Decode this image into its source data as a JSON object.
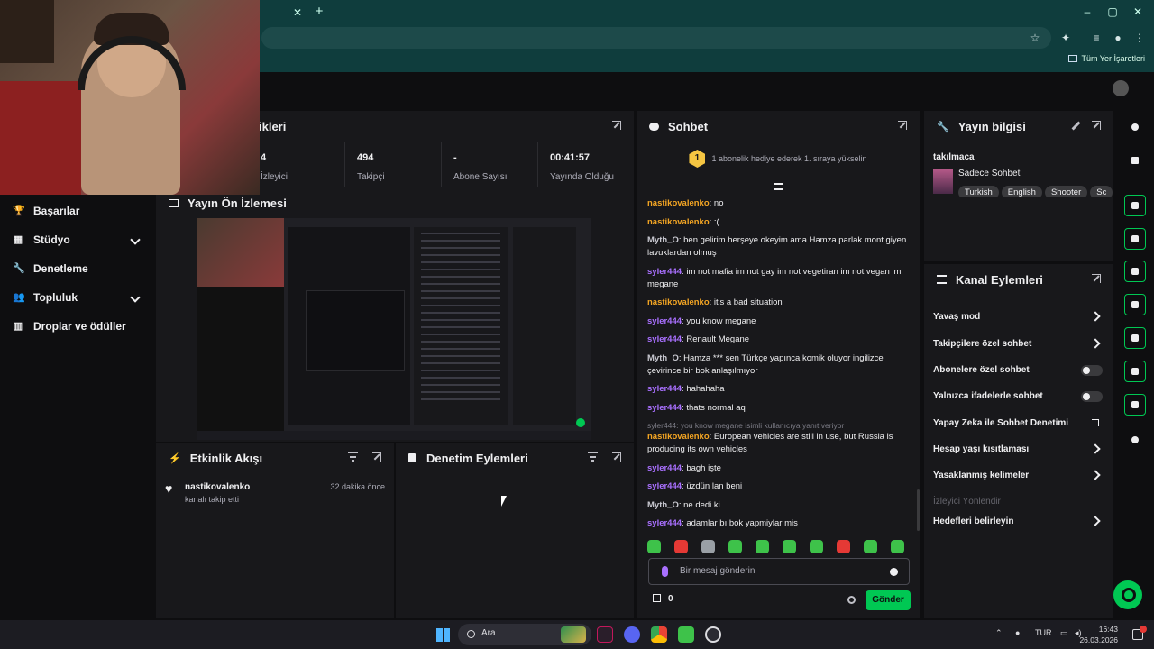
{
  "left_nav": {
    "items": [
      {
        "label": "Başarılar",
        "icon": "trophy-icon"
      },
      {
        "label": "Stüdyo",
        "icon": "studio-icon"
      },
      {
        "label": "Denetleme",
        "icon": "wrench-icon"
      },
      {
        "label": "Topluluk",
        "icon": "community-icon"
      },
      {
        "label": "Droplar ve ödüller",
        "icon": "drops-icon"
      }
    ]
  },
  "stats": {
    "title": "ikleri",
    "items": [
      {
        "value": "4",
        "label": "İzleyici"
      },
      {
        "value": "494",
        "label": "Takipçi"
      },
      {
        "value": "-",
        "label": "Abone Sayısı"
      },
      {
        "value": "00:41:57",
        "label": "Yayında Olduğu"
      }
    ]
  },
  "preview": {
    "title": "Yayın Ön İzlemesi"
  },
  "activity": {
    "title": "Etkinlik Akışı",
    "events": [
      {
        "name": "nastikovalenko",
        "desc": "kanalı takip etti",
        "time": "32 dakika önce"
      }
    ]
  },
  "moderation": {
    "title": "Denetim Eylemleri"
  },
  "chat": {
    "title": "Sohbet",
    "pinned_rank": "1",
    "pinned_text": "1 abonelik hediye ederek 1. sıraya yükselin",
    "input_placeholder": "Bir mesaj gönderin",
    "points": "0",
    "send_label": "Gönder",
    "messages": [
      {
        "user": "nastikovalenko",
        "color": "#f5a623",
        "text": "no"
      },
      {
        "user": "nastikovalenko",
        "color": "#f5a623",
        "text": ":("
      },
      {
        "user": "Myth_O",
        "color": "#c9c9d1",
        "text": "ben gelirim herşeye okeyim ama Hamza parlak mont giyen lavuklardan olmuş"
      },
      {
        "user": "syler444",
        "color": "#a970ff",
        "text": "im not mafia im not gay im not vegetiran im not vegan im megane"
      },
      {
        "user": "nastikovalenko",
        "color": "#f5a623",
        "text": "it's a bad situation"
      },
      {
        "user": "syler444",
        "color": "#a970ff",
        "text": "you know megane"
      },
      {
        "user": "syler444",
        "color": "#a970ff",
        "text": "Renault Megane"
      },
      {
        "user": "Myth_O",
        "color": "#c9c9d1",
        "text": "Hamza *** sen Türkçe yapınca komik oluyor ingilizce çevirince bir bok anlaşılmıyor"
      },
      {
        "user": "syler444",
        "color": "#a970ff",
        "text": "hahahaha"
      },
      {
        "user": "syler444",
        "color": "#a970ff",
        "text": "thats normal aq"
      },
      {
        "user": "nastikovalenko",
        "color": "#f5a623",
        "text": "European vehicles are still in use, but Russia is producing its own vehicles",
        "reply": "syler444: you know megane isimli kullanıcıya yanıt veriyor"
      },
      {
        "user": "syler444",
        "color": "#a970ff",
        "text": "bagh işte"
      },
      {
        "user": "syler444",
        "color": "#a970ff",
        "text": "üzdün lan beni"
      },
      {
        "user": "Myth_O",
        "color": "#c9c9d1",
        "text": "ne dedi ki"
      },
      {
        "user": "syler444",
        "color": "#a970ff",
        "text": "adamlar bı bok yapmiylar mis"
      }
    ]
  },
  "stream_info": {
    "title": "Yayın bilgisi",
    "stream_title": "takılmaca",
    "category": "Sadece Sohbet",
    "tags": [
      "Turkish",
      "English",
      "Shooter",
      "Sc"
    ]
  },
  "channel_actions": {
    "title": "Kanal Eylemleri",
    "items": [
      {
        "label": "Yavaş mod",
        "control": "arrow"
      },
      {
        "label": "Takipçilere özel sohbet",
        "control": "arrow"
      },
      {
        "label": "Abonelere özel sohbet",
        "control": "toggle"
      },
      {
        "label": "Yalnızca ifadelerle sohbet",
        "control": "toggle"
      },
      {
        "label": "Yapay Zeka ile Sohbet Denetimi",
        "control": "external"
      },
      {
        "label": "Hesap yaşı kısıtlaması",
        "control": "arrow"
      },
      {
        "label": "Yasaklanmış kelimeler",
        "control": "arrow"
      },
      {
        "label": "İzleyici Yönlendir",
        "control": "disabled"
      },
      {
        "label": "Hedefleri belirleyin",
        "control": "arrow"
      }
    ]
  },
  "browser": {
    "bookmarks_label": "Tüm Yer İşaretleri"
  },
  "taskbar": {
    "search": "Ara",
    "lang": "TUR",
    "time": "16:43",
    "date": "26.03.2026"
  },
  "colors": {
    "accent": "#00c853",
    "purple": "#a970ff",
    "panel": "#18181b",
    "bg": "#0e0e10"
  }
}
